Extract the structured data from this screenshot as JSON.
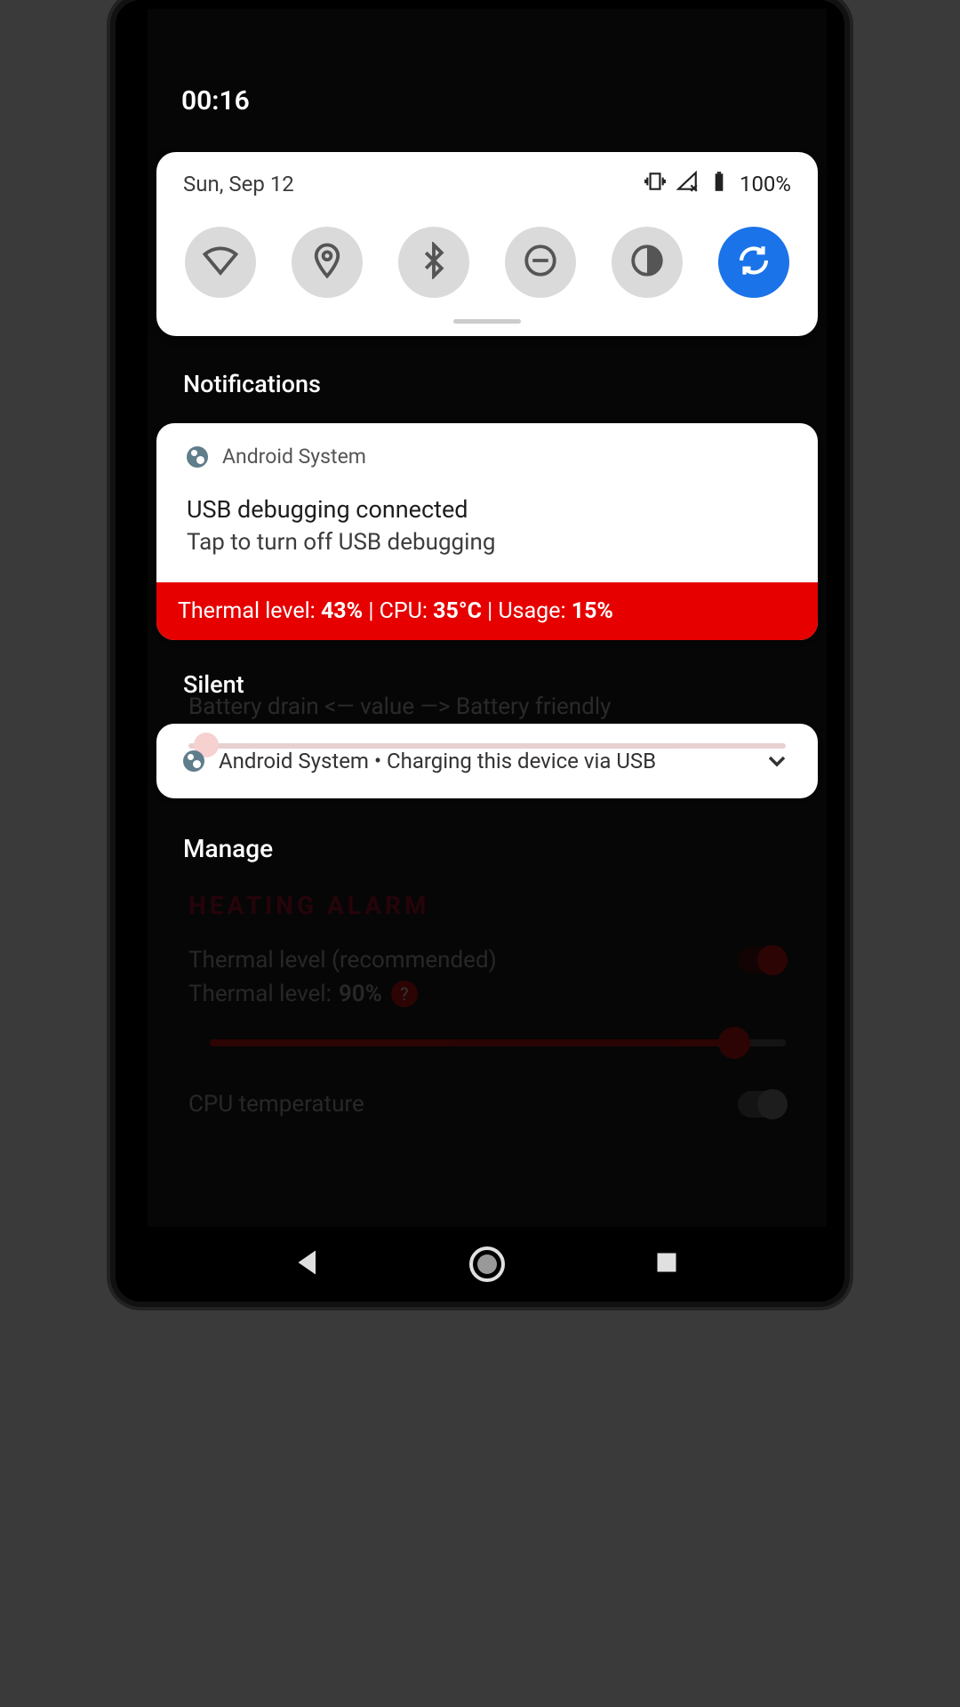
{
  "status": {
    "time": "00:16",
    "date": "Sun, Sep 12",
    "battery_pct": "100%"
  },
  "qs_tiles": [
    {
      "name": "wifi",
      "active": false
    },
    {
      "name": "location",
      "active": false
    },
    {
      "name": "bluetooth",
      "active": false
    },
    {
      "name": "dnd",
      "active": false
    },
    {
      "name": "dark-theme",
      "active": false
    },
    {
      "name": "auto-rotate",
      "active": true
    }
  ],
  "sections": {
    "notifications": "Notifications",
    "silent": "Silent",
    "manage": "Manage"
  },
  "notifications": {
    "usb_debug": {
      "app": "Android System",
      "title": "USB debugging connected",
      "body": "Tap to turn off USB debugging"
    },
    "thermal_overlay": {
      "label_thermal": "Thermal level:",
      "thermal_pct": "43%",
      "label_cpu": "CPU:",
      "cpu_temp": "35°C",
      "label_usage": "Usage:",
      "usage_pct": "15%"
    },
    "charging": {
      "app": "Android System",
      "separator": "•",
      "text": "Charging this device via USB"
    }
  },
  "background_app": {
    "slider_hint": "Battery drain <— value —> Battery friendly",
    "alarm_header": "HEATING ALARM",
    "thermal_row_label": "Thermal level (recommended)",
    "thermal_value_label": "Thermal level:",
    "thermal_value_pct": "90%",
    "cpu_row_label": "CPU temperature"
  }
}
